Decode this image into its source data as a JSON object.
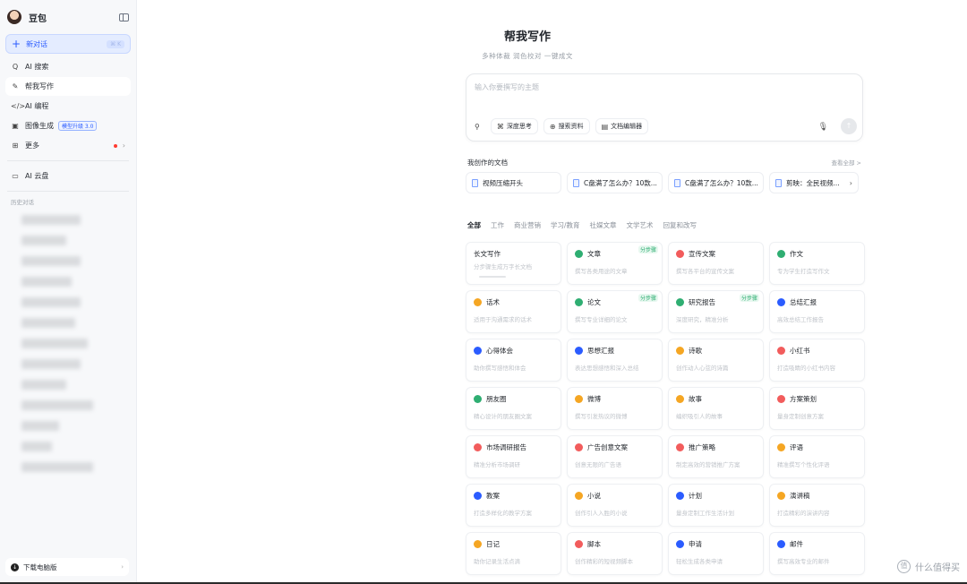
{
  "app": {
    "name": "豆包"
  },
  "sidebar": {
    "new_chat": "新对话",
    "new_chat_shortcut": "⌘ K",
    "items": [
      {
        "icon": "Q",
        "label": "AI 搜索"
      },
      {
        "icon": "✎",
        "label": "帮我写作"
      },
      {
        "icon": "</>",
        "label": "AI 编程"
      },
      {
        "icon": "▣",
        "label": "图像生成",
        "badge": "模型升级 3.0"
      },
      {
        "icon": "⊞",
        "label": "更多"
      }
    ],
    "cloud": "AI 云盘",
    "history_title": "历史对话",
    "download": "下载电脑版"
  },
  "main": {
    "title": "帮我写作",
    "subtitle": "多种体裁   润色校对   一键成文",
    "input_placeholder": "输入你要撰写的主题",
    "tools": {
      "deep": "深度思考",
      "search": "搜索资料",
      "editor": "文档编辑器"
    },
    "docs_title": "我创作的文档",
    "docs_more": "查看全部 >",
    "docs": [
      "视频压缩开头",
      "C盘满了怎么办？10款...",
      "C盘满了怎么办？10款...",
      "剪映：全民视频..."
    ],
    "tabs": [
      "全部",
      "工作",
      "商业营销",
      "学习/教育",
      "社媒文章",
      "文学艺术",
      "回复和改写"
    ],
    "cards": [
      {
        "title": "长文写作",
        "desc": "分步骤生成万字长文档",
        "color": "",
        "tag": ""
      },
      {
        "title": "文章",
        "desc": "撰写各类用途的文章",
        "color": "#2fae72",
        "tag": "分步骤"
      },
      {
        "title": "宣传文案",
        "desc": "撰写各平台的宣传文案",
        "color": "#f25c5c",
        "tag": ""
      },
      {
        "title": "作文",
        "desc": "专为学生打造写作文",
        "color": "#2fae72",
        "tag": ""
      },
      {
        "title": "话术",
        "desc": "适用于沟通需求的话术",
        "color": "#f5a623",
        "tag": ""
      },
      {
        "title": "论文",
        "desc": "撰写专业详细的论文",
        "color": "#2fae72",
        "tag": "分步骤"
      },
      {
        "title": "研究报告",
        "desc": "深度研究，精准分析",
        "color": "#2fae72",
        "tag": "分步骤"
      },
      {
        "title": "总结汇报",
        "desc": "高效总结工作报告",
        "color": "#2b5cff",
        "tag": ""
      },
      {
        "title": "心得体会",
        "desc": "助你撰写感悟和体会",
        "color": "#2b5cff",
        "tag": ""
      },
      {
        "title": "思想汇报",
        "desc": "表达思想感悟和深入总结",
        "color": "#2b5cff",
        "tag": ""
      },
      {
        "title": "诗歌",
        "desc": "创作动人心弦的诗篇",
        "color": "#f5a623",
        "tag": ""
      },
      {
        "title": "小红书",
        "desc": "打造吸睛的小红书内容",
        "color": "#f25c5c",
        "tag": ""
      },
      {
        "title": "朋友圈",
        "desc": "精心设计的朋友圈文案",
        "color": "#2fae72",
        "tag": ""
      },
      {
        "title": "微博",
        "desc": "撰写引发热议的微博",
        "color": "#f5a623",
        "tag": ""
      },
      {
        "title": "故事",
        "desc": "编织吸引人的故事",
        "color": "#f5a623",
        "tag": ""
      },
      {
        "title": "方案策划",
        "desc": "量身定制创意方案",
        "color": "#f25c5c",
        "tag": ""
      },
      {
        "title": "市场调研报告",
        "desc": "精准分析市场调研",
        "color": "#f25c5c",
        "tag": ""
      },
      {
        "title": "广告创意文案",
        "desc": "创意无限的广告语",
        "color": "#f25c5c",
        "tag": ""
      },
      {
        "title": "推广策略",
        "desc": "制定高效的营销推广方案",
        "color": "#f25c5c",
        "tag": ""
      },
      {
        "title": "评语",
        "desc": "精准撰写个性化评语",
        "color": "#f5a623",
        "tag": ""
      },
      {
        "title": "教案",
        "desc": "打造多样化的教学方案",
        "color": "#2b5cff",
        "tag": ""
      },
      {
        "title": "小说",
        "desc": "创作引人入胜的小说",
        "color": "#f5a623",
        "tag": ""
      },
      {
        "title": "计划",
        "desc": "量身定制工作生活计划",
        "color": "#2b5cff",
        "tag": ""
      },
      {
        "title": "演讲稿",
        "desc": "打造精彩的演讲内容",
        "color": "#f5a623",
        "tag": ""
      },
      {
        "title": "日记",
        "desc": "助你记录生活点滴",
        "color": "#f5a623",
        "tag": ""
      },
      {
        "title": "脚本",
        "desc": "创作精彩的短视频脚本",
        "color": "#f25c5c",
        "tag": ""
      },
      {
        "title": "申请",
        "desc": "轻松生成各类申请",
        "color": "#2b5cff",
        "tag": ""
      },
      {
        "title": "邮件",
        "desc": "撰写高效专业的邮件",
        "color": "#2b5cff",
        "tag": ""
      }
    ]
  },
  "watermark": "什么值得买"
}
